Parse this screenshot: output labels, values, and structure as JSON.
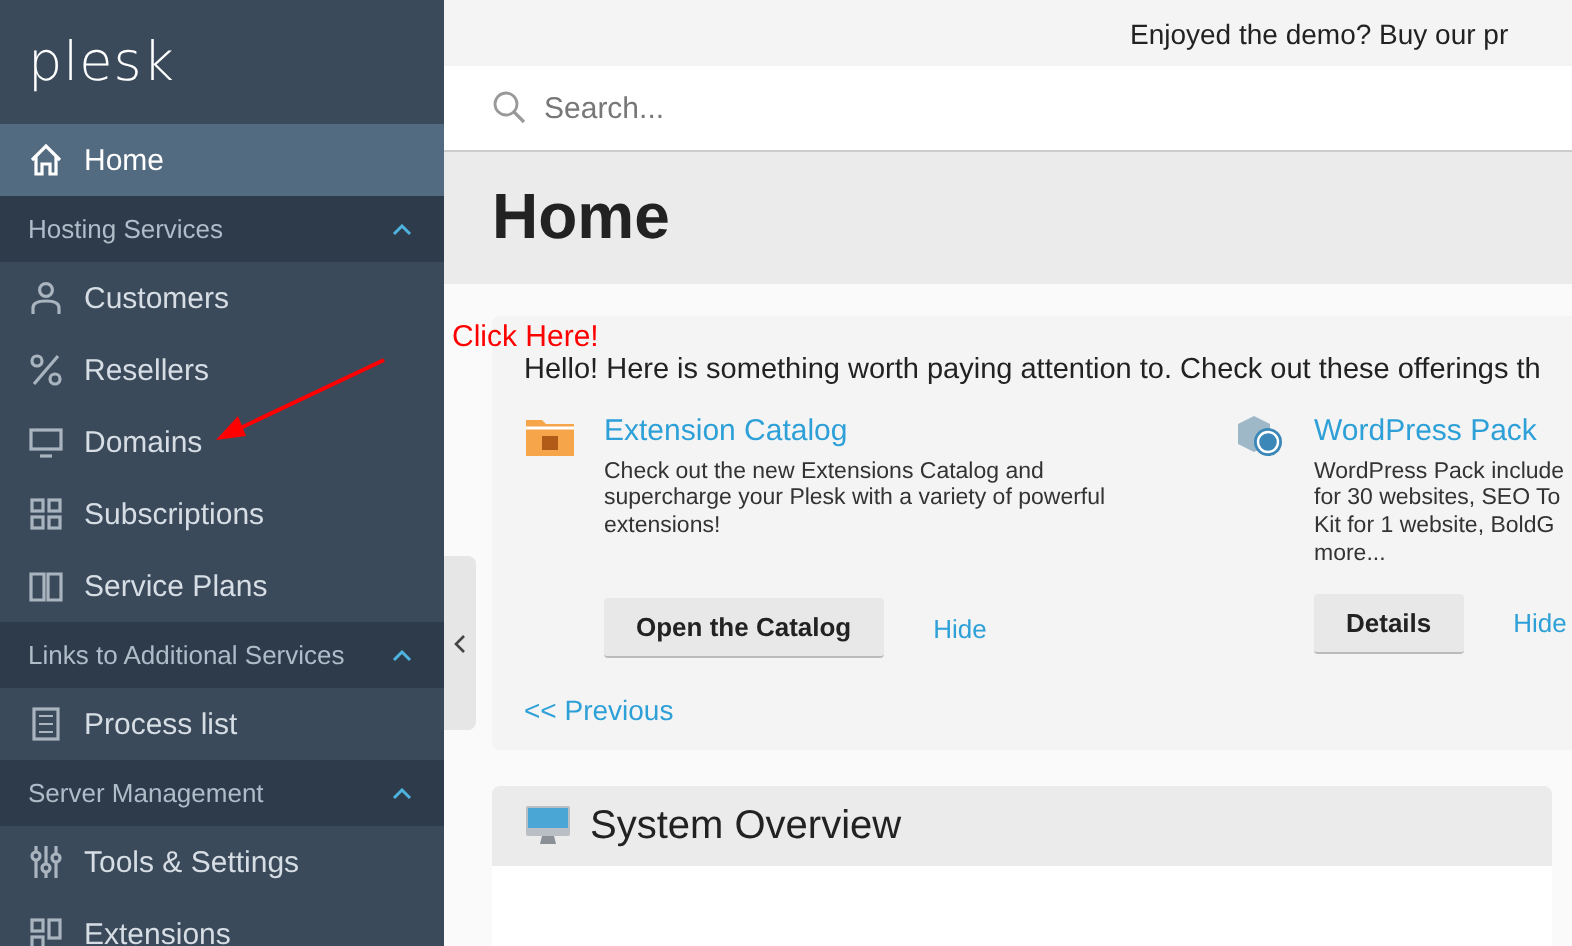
{
  "sidebar": {
    "logo": "plesk",
    "items": [
      {
        "kind": "item",
        "label": "Home",
        "selected": true
      },
      {
        "kind": "section",
        "label": "Hosting Services",
        "expanded": true
      },
      {
        "kind": "item",
        "label": "Customers",
        "selected": false
      },
      {
        "kind": "item",
        "label": "Resellers",
        "selected": false
      },
      {
        "kind": "item",
        "label": "Domains",
        "selected": false
      },
      {
        "kind": "item",
        "label": "Subscriptions",
        "selected": false
      },
      {
        "kind": "item",
        "label": "Service Plans",
        "selected": false
      },
      {
        "kind": "section",
        "label": "Links to Additional Services",
        "expanded": true
      },
      {
        "kind": "item",
        "label": "Process list",
        "selected": false
      },
      {
        "kind": "section",
        "label": "Server Management",
        "expanded": true
      },
      {
        "kind": "item",
        "label": "Tools & Settings",
        "selected": false
      },
      {
        "kind": "item",
        "label": "Extensions",
        "selected": false
      }
    ]
  },
  "top_bar": {
    "message": "Enjoyed the demo? Buy our pr"
  },
  "search": {
    "placeholder": "Search..."
  },
  "page_title": "Home",
  "promo": {
    "intro": "Hello! Here is something worth paying attention to. Check out these offerings th",
    "offers": [
      {
        "title": "Extension Catalog",
        "description": "Check out the new Extensions Catalog and\nsupercharge your Plesk with a variety of powerful\nextensions!",
        "button": "Open the Catalog",
        "hide": "Hide"
      },
      {
        "title": "WordPress Pack",
        "description": "WordPress Pack include\nfor 30 websites, SEO To\nKit for 1 website, BoldG\nmore...",
        "button": "Details",
        "hide": "Hide"
      }
    ],
    "previous": "<< Previous"
  },
  "system_overview": {
    "title": "System Overview"
  },
  "annotation": {
    "text": "Click Here!"
  }
}
